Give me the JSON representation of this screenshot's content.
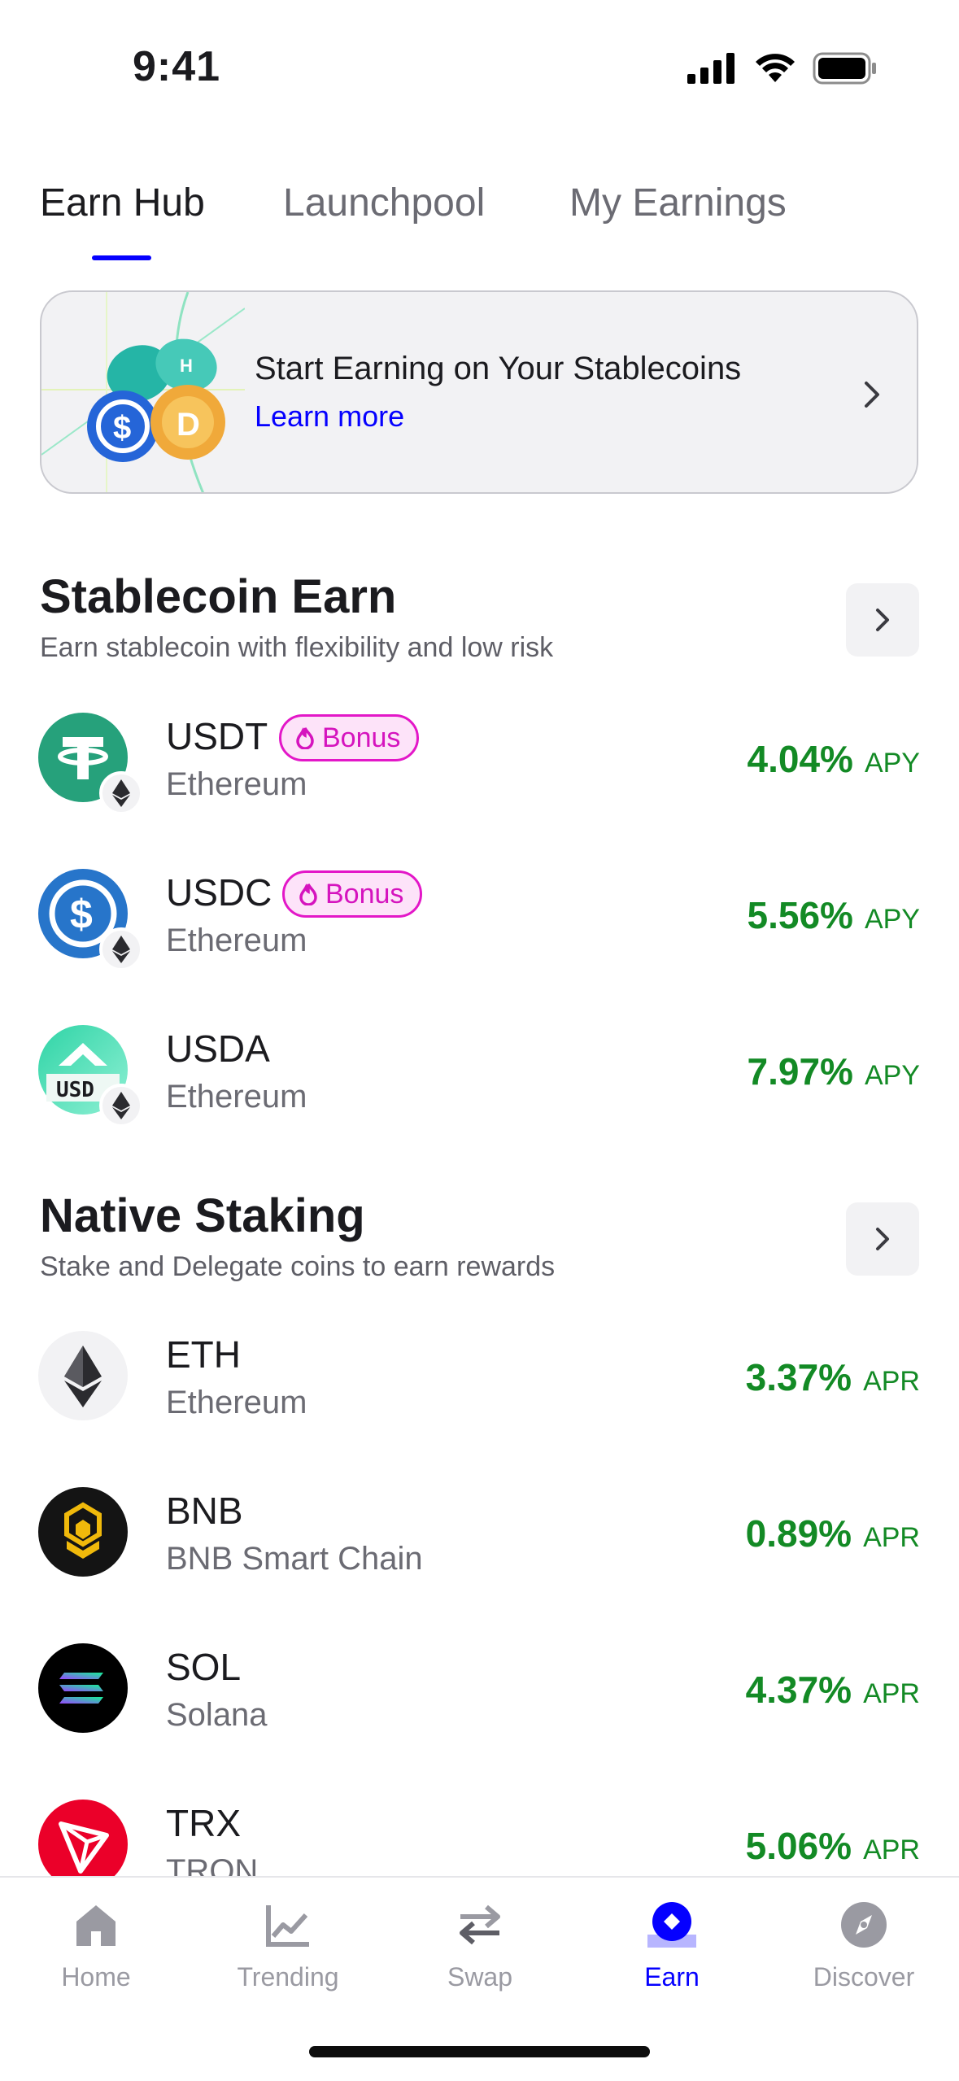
{
  "status_bar": {
    "time": "9:41"
  },
  "tabs": [
    {
      "label": "Earn Hub",
      "active": true
    },
    {
      "label": "Launchpool",
      "active": false
    },
    {
      "label": "My Earnings",
      "active": false
    }
  ],
  "banner": {
    "title": "Start Earning on Your Stablecoins",
    "link": "Learn more"
  },
  "stablecoin_section": {
    "title": "Stablecoin Earn",
    "subtitle": "Earn stablecoin with flexibility and low risk",
    "items": [
      {
        "symbol": "USDT",
        "chain": "Ethereum",
        "badge": "Bonus",
        "rate": "4.04%",
        "unit": "APY",
        "icon_color": "#26a17b"
      },
      {
        "symbol": "USDC",
        "chain": "Ethereum",
        "badge": "Bonus",
        "rate": "5.56%",
        "unit": "APY",
        "icon_color": "#2775ca"
      },
      {
        "symbol": "USDA",
        "chain": "Ethereum",
        "badge": "",
        "rate": "7.97%",
        "unit": "APY",
        "icon_color": "#3ddbb0",
        "icon_text": "USD"
      }
    ]
  },
  "staking_section": {
    "title": "Native Staking",
    "subtitle": "Stake and Delegate coins to earn rewards",
    "items": [
      {
        "symbol": "ETH",
        "chain": "Ethereum",
        "rate": "3.37%",
        "unit": "APR",
        "icon_color": "#f2f2f4"
      },
      {
        "symbol": "BNB",
        "chain": "BNB Smart Chain",
        "rate": "0.89%",
        "unit": "APR",
        "icon_color": "#141414"
      },
      {
        "symbol": "SOL",
        "chain": "Solana",
        "rate": "4.37%",
        "unit": "APR",
        "icon_color": "#000000"
      },
      {
        "symbol": "TRX",
        "chain": "TRON",
        "rate": "5.06%",
        "unit": "APR",
        "icon_color": "#eb0029"
      }
    ]
  },
  "bottom_nav": [
    {
      "label": "Home",
      "icon": "home-icon",
      "active": false
    },
    {
      "label": "Trending",
      "icon": "trending-icon",
      "active": false
    },
    {
      "label": "Swap",
      "icon": "swap-icon",
      "active": false
    },
    {
      "label": "Earn",
      "icon": "earn-icon",
      "active": true
    },
    {
      "label": "Discover",
      "icon": "discover-icon",
      "active": false
    }
  ],
  "colors": {
    "accent": "#0500ff",
    "positive": "#138a25",
    "bonus": "#e317c8"
  }
}
